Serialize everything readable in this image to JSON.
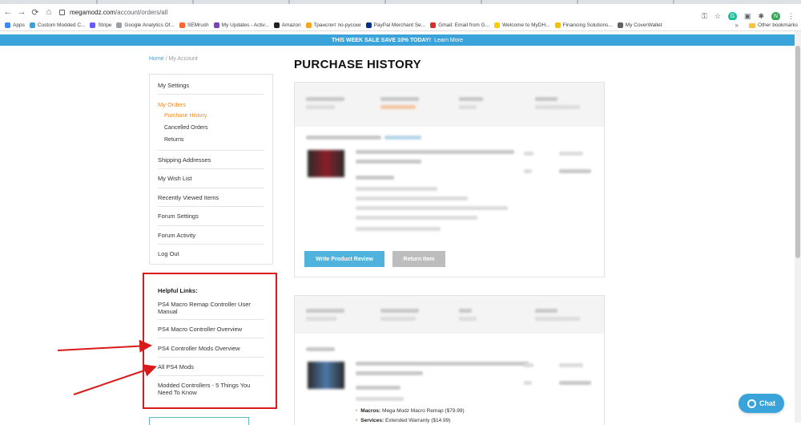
{
  "browser": {
    "url_host": "megamodz.com",
    "url_path": "/account/orders/all",
    "avatar_letter": "N",
    "bookmarks": [
      {
        "label": "Apps",
        "color": "#4285f4"
      },
      {
        "label": "Custom Modded C...",
        "color": "#3aa3d9"
      },
      {
        "label": "Stripe",
        "color": "#635bff"
      },
      {
        "label": "Google Analytics Of...",
        "color": "#9aa0a6"
      },
      {
        "label": "SEMrush",
        "color": "#ff642d"
      },
      {
        "label": "My Updates - Activ...",
        "color": "#7b42bc"
      },
      {
        "label": "Amazon",
        "color": "#222222"
      },
      {
        "label": "Транслит по-русски",
        "color": "#f5a623"
      },
      {
        "label": "PayPal Merchant Se...",
        "color": "#003087"
      },
      {
        "label": "Gmail: Email from G...",
        "color": "#d93025"
      },
      {
        "label": "Welcome to MyDH...",
        "color": "#ffcc00"
      },
      {
        "label": "Financing Solutions...",
        "color": "#f2c200"
      },
      {
        "label": "My CoverWallet",
        "color": "#5f6368"
      }
    ],
    "other_bookmarks": "Other bookmarks",
    "more": "»"
  },
  "promo": {
    "text": "THIS WEEK SALE SAVE 10% TODAY!",
    "link": "Learn More"
  },
  "breadcrumb": {
    "home": "Home",
    "sep": "/",
    "current": "My Account"
  },
  "sidebar": {
    "settings": "My Settings",
    "orders": "My Orders",
    "purchase_history": "Purchase History",
    "cancelled": "Cancelled Orders",
    "returns": "Returns",
    "shipping": "Shipping Addresses",
    "wishlist": "My Wish List",
    "recent": "Recently Viewed Items",
    "forum_settings": "Forum Settings",
    "forum_activity": "Forum Activity",
    "logout": "Log Out"
  },
  "helpful": {
    "title": "Helpful Links:",
    "links": [
      "PS4 Macro Remap Controller User Manual",
      "PS4 Macro Controller Overview",
      "PS4 Controller Mods Overview",
      "All PS4 Mods",
      "Modded Controllers - 5 Things You Need To Know"
    ]
  },
  "main": {
    "title": "PURCHASE HISTORY",
    "write_review": "Write Product Review",
    "return_item": "Return Item",
    "bullets": [
      {
        "label": "Macros:",
        "value": "Mega Modz Macro Remap ($79.99)"
      },
      {
        "label": "Services:",
        "value": "Extended Warranty ($14.99)"
      }
    ]
  },
  "chat": {
    "label": "Chat"
  },
  "colors": {
    "accent": "#3aa3d9",
    "orange": "#f08a24",
    "annotation_red": "#d91b1b"
  }
}
